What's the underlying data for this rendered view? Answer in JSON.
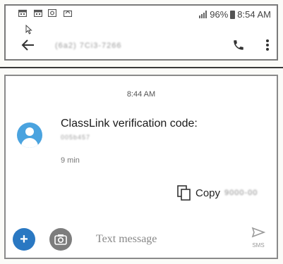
{
  "status_bar": {
    "battery_text": "96%",
    "time": "8:54 AM",
    "icons": [
      "calendar-icon",
      "calendar-icon",
      "photo-icon",
      "voicemail-icon",
      "signal-icon",
      "battery-icon"
    ]
  },
  "toolbar": {
    "title": "(6a2) 7Ci3-7266",
    "icons": [
      "back-arrow-icon",
      "phone-icon",
      "more-vert-icon"
    ]
  },
  "conversation": {
    "timestamp": "8:44 AM",
    "message": {
      "text": "ClassLink verification code:",
      "code": "005b457",
      "time": "9 min"
    },
    "copy_chip": {
      "label": "Copy",
      "code": "9000-00"
    }
  },
  "compose": {
    "placeholder": "Text message",
    "send_label": "SMS",
    "icons": [
      "add-icon",
      "camera-icon",
      "send-icon"
    ]
  },
  "colors": {
    "avatar": "#4aa3df",
    "add_button": "#2a78c2",
    "camera_button": "#7d7d7d"
  }
}
